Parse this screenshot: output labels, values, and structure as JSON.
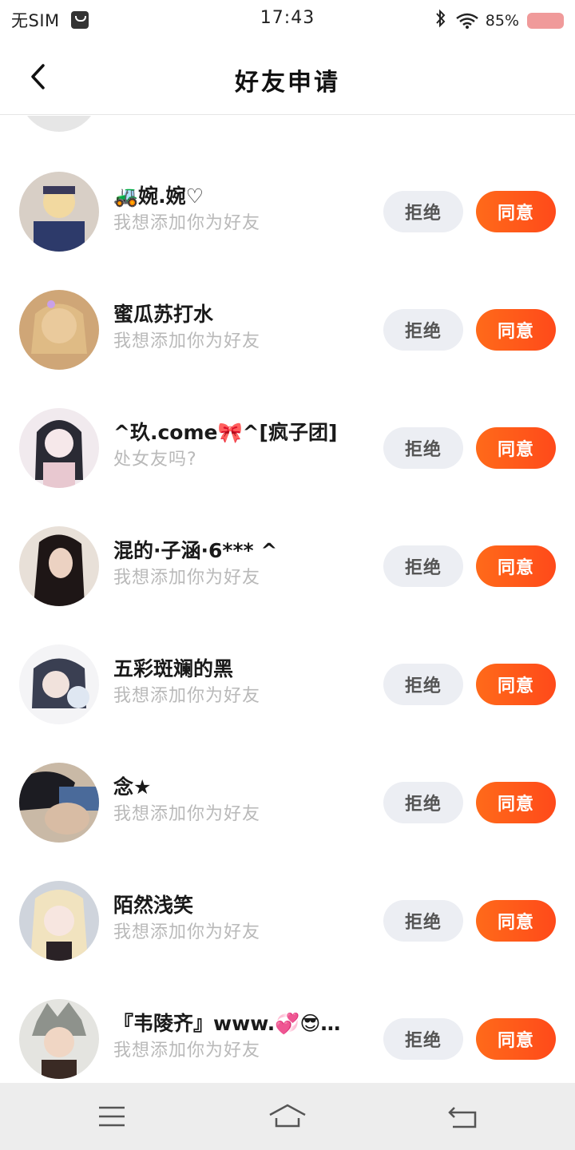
{
  "status_bar": {
    "carrier": "无SIM",
    "time": "17:43",
    "battery": "85%"
  },
  "header": {
    "title": "好友申请"
  },
  "buttons": {
    "reject": "拒绝",
    "accept": "同意"
  },
  "requests": [
    {
      "name": "🚜婉.婉♡",
      "message": "我想添加你为好友",
      "avatar_color": "#c8b7a8"
    },
    {
      "name": "蜜瓜苏打水",
      "message": "我想添加你为好友",
      "avatar_color": "#d9b48a"
    },
    {
      "name": "^玖.come🎀^[疯子团]",
      "message": "处女友吗?",
      "avatar_color": "#e8dde2"
    },
    {
      "name": "混的·子涵·6*** ^",
      "message": "我想添加你为好友",
      "avatar_color": "#3a2a28"
    },
    {
      "name": "五彩斑斓的黑",
      "message": "我想添加你为好友",
      "avatar_color": "#a8aebc"
    },
    {
      "name": "念★",
      "message": "我想添加你为好友",
      "avatar_color": "#5a5a6a"
    },
    {
      "name": "陌然浅笑",
      "message": "我想添加你为好友",
      "avatar_color": "#f2e4c8"
    },
    {
      "name": "『韦陵齐』www.💞😎…",
      "message": "我想添加你为好友",
      "avatar_color": "#9aa098"
    }
  ],
  "colors": {
    "accent": "#ff5a1a",
    "reject_bg": "#eceef3",
    "message_text": "#b9b9b9"
  }
}
